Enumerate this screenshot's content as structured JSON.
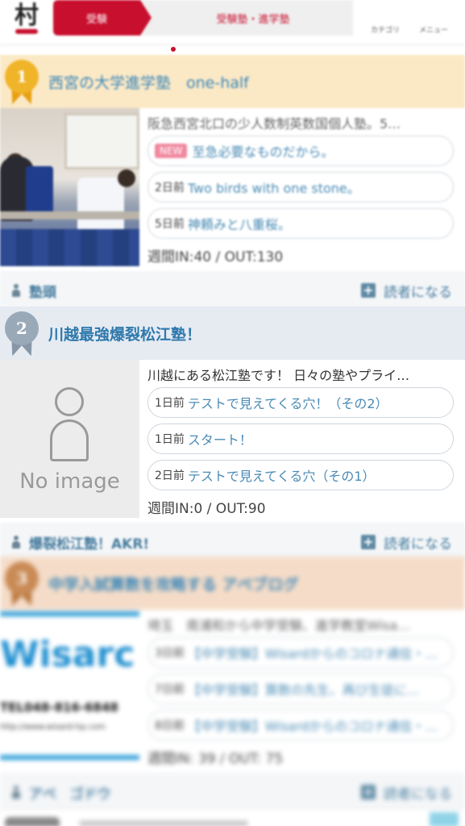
{
  "header": {
    "logo_text": "村",
    "tab_active_label": "受験",
    "tab_second_label": "受験塾・進学塾",
    "category_label": "カテゴリ",
    "menu_label": "メニュー"
  },
  "entries": [
    {
      "rank": "1",
      "title": "西宮の大学進学塾　one-half",
      "description": "阪急西宮北口の少人数制英数国個人塾。5…",
      "articles": [
        {
          "days": "",
          "new": "NEW",
          "title": "至急必要なものだから。"
        },
        {
          "days": "2日前",
          "title": "Two birds with one stone。"
        },
        {
          "days": "5日前",
          "title": "神頼みと八重桜。"
        }
      ],
      "stats": "週間IN:40 / OUT:130",
      "owner": "塾頭",
      "subscribe_label": "読者になる"
    },
    {
      "rank": "2",
      "title": "川越最強爆裂松江塾！",
      "description": "川越にある松江塾です！ 日々の塾やプライ…",
      "no_image_label": "No image",
      "articles": [
        {
          "days": "1日前",
          "title": "テストで見えてくる穴！（その2）"
        },
        {
          "days": "1日前",
          "title": "スタート！"
        },
        {
          "days": "2日前",
          "title": "テストで見えてくる穴（その1）"
        }
      ],
      "stats": "週間IN:0 / OUT:90",
      "owner": "爆裂松江塾！AKR!",
      "subscribe_label": "読者になる"
    },
    {
      "rank": "3",
      "title": "中学入試算数を攻略する アベブログ",
      "description": "埼玉　南浦和から中学受験、進学教室Wisa…",
      "thumb_name": "Wisarc",
      "thumb_tel": "TEL048-816-6848",
      "thumb_url": "http://www.wisard-hp.com",
      "articles": [
        {
          "days": "3日前",
          "title": "【中学受験】Wisardからのコロナ通信・…"
        },
        {
          "days": "7日前",
          "title": "【中学受験】算数の先生、再び生徒に…"
        },
        {
          "days": "8日前",
          "title": "【中学受験】Wisardからのコロナ通信・…"
        }
      ],
      "stats": "週間IN: 39 / OUT: 75",
      "owner": "アベ　ゴドウ",
      "subscribe_label": "読者になる"
    }
  ],
  "colors": {
    "brand_red": "#c8102e",
    "link_blue": "#4a8bb5",
    "gold": "#f0b429",
    "silver": "#9aa9b8",
    "bronze": "#c98a55"
  },
  "icons": {
    "category": "grid-icon",
    "menu": "menu-icon",
    "owner": "person-icon",
    "subscribe": "plus-icon"
  }
}
